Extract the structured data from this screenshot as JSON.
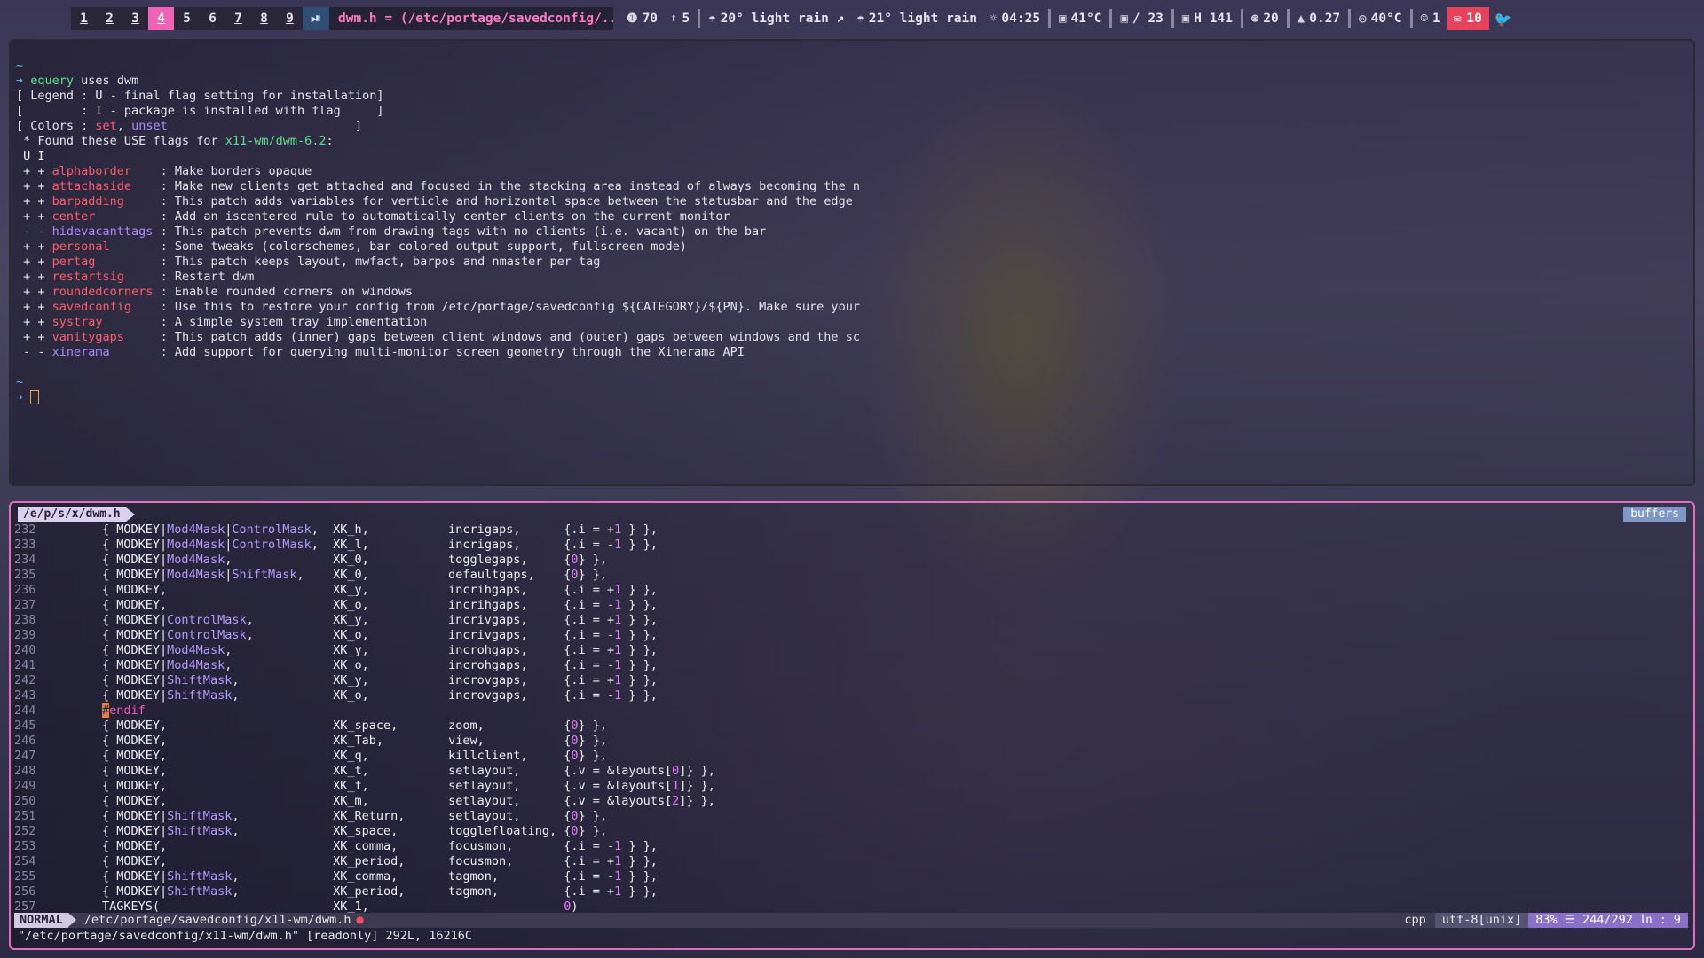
{
  "topbar": {
    "tags": [
      "1",
      "2",
      "3",
      "4",
      "5",
      "6",
      "7",
      "8",
      "9"
    ],
    "active_tag": "4",
    "layout_symbol": "⏯",
    "window_title": "dwm.h = (/etc/portage/savedconfig/...",
    "modules": [
      {
        "icon": "❶",
        "text": "70"
      },
      {
        "icon": "⬆",
        "text": "5"
      },
      {
        "icon": "☂",
        "text": "20° light rain ↗"
      },
      {
        "icon": "☂",
        "text": "21° light rain"
      },
      {
        "icon": "☼",
        "text": "04:25"
      },
      {
        "icon": "▣",
        "text": "41°C"
      },
      {
        "icon": "▣",
        "text": "/ 23"
      },
      {
        "icon": "▣",
        "text": "H 141"
      },
      {
        "icon": "⊛",
        "text": "20"
      },
      {
        "icon": "▲",
        "text": "0.27"
      },
      {
        "icon": "◎",
        "text": "40°C"
      },
      {
        "icon": "☺",
        "text": "1"
      }
    ],
    "mail_count": "10",
    "twitter_icon": "twitter-icon"
  },
  "terminal": {
    "lines": [
      [
        {
          "t": "~",
          "c": "c-b"
        }
      ],
      [
        {
          "t": "➔ ",
          "c": "c-b"
        },
        {
          "t": "equery",
          "c": "c-g"
        },
        {
          "t": " uses dwm",
          "c": ""
        }
      ],
      [
        {
          "t": "[ Legend : ",
          "c": ""
        },
        {
          "t": "U",
          "c": "c-w"
        },
        {
          "t": " - final flag setting for installation]",
          "c": ""
        }
      ],
      [
        {
          "t": "[        : ",
          "c": ""
        },
        {
          "t": "I",
          "c": "c-w"
        },
        {
          "t": " - package is installed with flag     ]",
          "c": ""
        }
      ],
      [
        {
          "t": "[ Colors : ",
          "c": ""
        },
        {
          "t": "set",
          "c": "c-r"
        },
        {
          "t": ", ",
          "c": ""
        },
        {
          "t": "unset",
          "c": "c-p"
        },
        {
          "t": "                          ]",
          "c": ""
        }
      ],
      [
        {
          "t": " * Found these USE flags for ",
          "c": ""
        },
        {
          "t": "x11-wm/dwm-6.2",
          "c": "c-g"
        },
        {
          "t": ":",
          "c": ""
        }
      ],
      [
        {
          "t": " U I",
          "c": "c-w"
        }
      ],
      [
        {
          "t": " + + ",
          "c": ""
        },
        {
          "t": "alphaborder    ",
          "c": "c-r"
        },
        {
          "t": ": Make borders opaque",
          "c": ""
        }
      ],
      [
        {
          "t": " + + ",
          "c": ""
        },
        {
          "t": "attachaside    ",
          "c": "c-r"
        },
        {
          "t": ": Make new clients get attached and focused in the stacking area instead of always becoming the n",
          "c": ""
        }
      ],
      [
        {
          "t": " + + ",
          "c": ""
        },
        {
          "t": "barpadding     ",
          "c": "c-r"
        },
        {
          "t": ": This patch adds variables for verticle and horizontal space between the statusbar and the edge",
          "c": ""
        }
      ],
      [
        {
          "t": " + + ",
          "c": ""
        },
        {
          "t": "center         ",
          "c": "c-r"
        },
        {
          "t": ": Add an iscentered rule to automatically center clients on the current monitor",
          "c": ""
        }
      ],
      [
        {
          "t": " - - ",
          "c": ""
        },
        {
          "t": "hidevacanttags ",
          "c": "c-p"
        },
        {
          "t": ": This patch prevents dwm from drawing tags with no clients (i.e. vacant) on the bar",
          "c": ""
        }
      ],
      [
        {
          "t": " + + ",
          "c": ""
        },
        {
          "t": "personal       ",
          "c": "c-r"
        },
        {
          "t": ": Some tweaks (colorschemes, bar colored output support, fullscreen mode)",
          "c": ""
        }
      ],
      [
        {
          "t": " + + ",
          "c": ""
        },
        {
          "t": "pertag         ",
          "c": "c-r"
        },
        {
          "t": ": This patch keeps layout, mwfact, barpos and nmaster per tag",
          "c": ""
        }
      ],
      [
        {
          "t": " + + ",
          "c": ""
        },
        {
          "t": "restartsig     ",
          "c": "c-r"
        },
        {
          "t": ": Restart dwm",
          "c": ""
        }
      ],
      [
        {
          "t": " + + ",
          "c": ""
        },
        {
          "t": "roundedcorners ",
          "c": "c-r"
        },
        {
          "t": ": Enable rounded corners on windows",
          "c": ""
        }
      ],
      [
        {
          "t": " + + ",
          "c": ""
        },
        {
          "t": "savedconfig    ",
          "c": "c-r"
        },
        {
          "t": ": Use this to restore your config from /etc/portage/savedconfig ${CATEGORY}/${PN}. Make sure your",
          "c": ""
        }
      ],
      [
        {
          "t": " + + ",
          "c": ""
        },
        {
          "t": "systray        ",
          "c": "c-r"
        },
        {
          "t": ": A simple system tray implementation",
          "c": ""
        }
      ],
      [
        {
          "t": " + + ",
          "c": ""
        },
        {
          "t": "vanitygaps     ",
          "c": "c-r"
        },
        {
          "t": ": This patch adds (inner) gaps between client windows and (outer) gaps between windows and the sc",
          "c": ""
        }
      ],
      [
        {
          "t": " - - ",
          "c": ""
        },
        {
          "t": "xinerama       ",
          "c": "c-p"
        },
        {
          "t": ": Add support for querying multi-monitor screen geometry through the Xinerama API",
          "c": ""
        }
      ],
      [
        {
          "t": " ",
          "c": ""
        }
      ],
      [
        {
          "t": "~",
          "c": "c-b"
        }
      ],
      [
        {
          "t": "➔ ",
          "c": "c-b"
        },
        {
          "t": "CURSOR",
          "c": "cursor"
        }
      ]
    ]
  },
  "vim": {
    "tab_file": "/e/p/s/x/dwm.h",
    "buffers_label": "buffers",
    "code": [
      {
        "n": "232",
        "segs": [
          [
            "        { MODKEY|",
            ""
          ],
          [
            "Mod4Mask",
            "kw"
          ],
          [
            "|",
            ""
          ],
          [
            "ControlMask",
            "kw"
          ],
          [
            ",  XK_h,           incrigaps,      {.i = +",
            ""
          ],
          [
            "1",
            "num"
          ],
          [
            " } },",
            ""
          ]
        ]
      },
      {
        "n": "233",
        "segs": [
          [
            "        { MODKEY|",
            ""
          ],
          [
            "Mod4Mask",
            "kw"
          ],
          [
            "|",
            ""
          ],
          [
            "ControlMask",
            "kw"
          ],
          [
            ",  XK_l,           incrigaps,      {.i = -",
            ""
          ],
          [
            "1",
            "num"
          ],
          [
            " } },",
            ""
          ]
        ]
      },
      {
        "n": "234",
        "segs": [
          [
            "        { MODKEY|",
            ""
          ],
          [
            "Mod4Mask",
            "kw"
          ],
          [
            ",              XK_0,           togglegaps,     {",
            ""
          ],
          [
            "0",
            "num"
          ],
          [
            "} },",
            ""
          ]
        ]
      },
      {
        "n": "235",
        "segs": [
          [
            "        { MODKEY|",
            ""
          ],
          [
            "Mod4Mask",
            "kw"
          ],
          [
            "|",
            ""
          ],
          [
            "ShiftMask",
            "kw"
          ],
          [
            ",    XK_0,           defaultgaps,    {",
            ""
          ],
          [
            "0",
            "num"
          ],
          [
            "} },",
            ""
          ]
        ]
      },
      {
        "n": "236",
        "segs": [
          [
            "        { MODKEY,                       XK_y,           incrihgaps,     {.i = +",
            ""
          ],
          [
            "1",
            "num"
          ],
          [
            " } },",
            ""
          ]
        ]
      },
      {
        "n": "237",
        "segs": [
          [
            "        { MODKEY,                       XK_o,           incrihgaps,     {.i = -",
            ""
          ],
          [
            "1",
            "num"
          ],
          [
            " } },",
            ""
          ]
        ]
      },
      {
        "n": "238",
        "segs": [
          [
            "        { MODKEY|",
            ""
          ],
          [
            "ControlMask",
            "kw"
          ],
          [
            ",           XK_y,           incrivgaps,     {.i = +",
            ""
          ],
          [
            "1",
            "num"
          ],
          [
            " } },",
            ""
          ]
        ]
      },
      {
        "n": "239",
        "segs": [
          [
            "        { MODKEY|",
            ""
          ],
          [
            "ControlMask",
            "kw"
          ],
          [
            ",           XK_o,           incrivgaps,     {.i = -",
            ""
          ],
          [
            "1",
            "num"
          ],
          [
            " } },",
            ""
          ]
        ]
      },
      {
        "n": "240",
        "segs": [
          [
            "        { MODKEY|",
            ""
          ],
          [
            "Mod4Mask",
            "kw"
          ],
          [
            ",              XK_y,           incrohgaps,     {.i = +",
            ""
          ],
          [
            "1",
            "num"
          ],
          [
            " } },",
            ""
          ]
        ]
      },
      {
        "n": "241",
        "segs": [
          [
            "        { MODKEY|",
            ""
          ],
          [
            "Mod4Mask",
            "kw"
          ],
          [
            ",              XK_o,           incrohgaps,     {.i = -",
            ""
          ],
          [
            "1",
            "num"
          ],
          [
            " } },",
            ""
          ]
        ]
      },
      {
        "n": "242",
        "segs": [
          [
            "        { MODKEY|",
            ""
          ],
          [
            "ShiftMask",
            "kw"
          ],
          [
            ",             XK_y,           incrovgaps,     {.i = +",
            ""
          ],
          [
            "1",
            "num"
          ],
          [
            " } },",
            ""
          ]
        ]
      },
      {
        "n": "243",
        "segs": [
          [
            "        { MODKEY|",
            ""
          ],
          [
            "ShiftMask",
            "kw"
          ],
          [
            ",             XK_o,           incrovgaps,     {.i = -",
            ""
          ],
          [
            "1",
            "num"
          ],
          [
            " } },",
            ""
          ]
        ]
      },
      {
        "n": "244",
        "segs": [
          [
            "        ",
            ""
          ],
          [
            "#",
            "hl"
          ],
          [
            "endif",
            "pp"
          ]
        ]
      },
      {
        "n": "245",
        "segs": [
          [
            "        { MODKEY,                       XK_space,       zoom,           {",
            ""
          ],
          [
            "0",
            "num"
          ],
          [
            "} },",
            ""
          ]
        ]
      },
      {
        "n": "246",
        "segs": [
          [
            "        { MODKEY,                       XK_Tab,         view,           {",
            ""
          ],
          [
            "0",
            "num"
          ],
          [
            "} },",
            ""
          ]
        ]
      },
      {
        "n": "247",
        "segs": [
          [
            "        { MODKEY,                       XK_q,           killclient,     {",
            ""
          ],
          [
            "0",
            "num"
          ],
          [
            "} },",
            ""
          ]
        ]
      },
      {
        "n": "248",
        "segs": [
          [
            "        { MODKEY,                       XK_t,           setlayout,      {.v = &layouts[",
            ""
          ],
          [
            "0",
            "num"
          ],
          [
            "]} },",
            ""
          ]
        ]
      },
      {
        "n": "249",
        "segs": [
          [
            "        { MODKEY,                       XK_f,           setlayout,      {.v = &layouts[",
            ""
          ],
          [
            "1",
            "num"
          ],
          [
            "]} },",
            ""
          ]
        ]
      },
      {
        "n": "250",
        "segs": [
          [
            "        { MODKEY,                       XK_m,           setlayout,      {.v = &layouts[",
            ""
          ],
          [
            "2",
            "num"
          ],
          [
            "]} },",
            ""
          ]
        ]
      },
      {
        "n": "251",
        "segs": [
          [
            "        { MODKEY|",
            ""
          ],
          [
            "ShiftMask",
            "kw"
          ],
          [
            ",             XK_Return,      setlayout,      {",
            ""
          ],
          [
            "0",
            "num"
          ],
          [
            "} },",
            ""
          ]
        ]
      },
      {
        "n": "252",
        "segs": [
          [
            "        { MODKEY|",
            ""
          ],
          [
            "ShiftMask",
            "kw"
          ],
          [
            ",             XK_space,       togglefloating, {",
            ""
          ],
          [
            "0",
            "num"
          ],
          [
            "} },",
            ""
          ]
        ]
      },
      {
        "n": "253",
        "segs": [
          [
            "        { MODKEY,                       XK_comma,       focusmon,       {.i = -",
            ""
          ],
          [
            "1",
            "num"
          ],
          [
            " } },",
            ""
          ]
        ]
      },
      {
        "n": "254",
        "segs": [
          [
            "        { MODKEY,                       XK_period,      focusmon,       {.i = +",
            ""
          ],
          [
            "1",
            "num"
          ],
          [
            " } },",
            ""
          ]
        ]
      },
      {
        "n": "255",
        "segs": [
          [
            "        { MODKEY|",
            ""
          ],
          [
            "ShiftMask",
            "kw"
          ],
          [
            ",             XK_comma,       tagmon,         {.i = -",
            ""
          ],
          [
            "1",
            "num"
          ],
          [
            " } },",
            ""
          ]
        ]
      },
      {
        "n": "256",
        "segs": [
          [
            "        { MODKEY|",
            ""
          ],
          [
            "ShiftMask",
            "kw"
          ],
          [
            ",             XK_period,      tagmon,         {.i = +",
            ""
          ],
          [
            "1",
            "num"
          ],
          [
            " } },",
            ""
          ]
        ]
      },
      {
        "n": "257",
        "segs": [
          [
            "        TAGKEYS(                        XK_1,                           ",
            ""
          ],
          [
            "0",
            "num"
          ],
          [
            ")",
            ""
          ]
        ]
      }
    ],
    "status": {
      "mode": "NORMAL",
      "path": "/etc/portage/savedconfig/x11-wm/dwm.h",
      "modified_dot": "●",
      "filetype": "cpp",
      "encoding": "utf-8[unix]",
      "position": "83% ☰ 244/292 ㏑ :  9"
    },
    "message": "\"/etc/portage/savedconfig/x11-wm/dwm.h\" [readonly] 292L, 16216C"
  }
}
